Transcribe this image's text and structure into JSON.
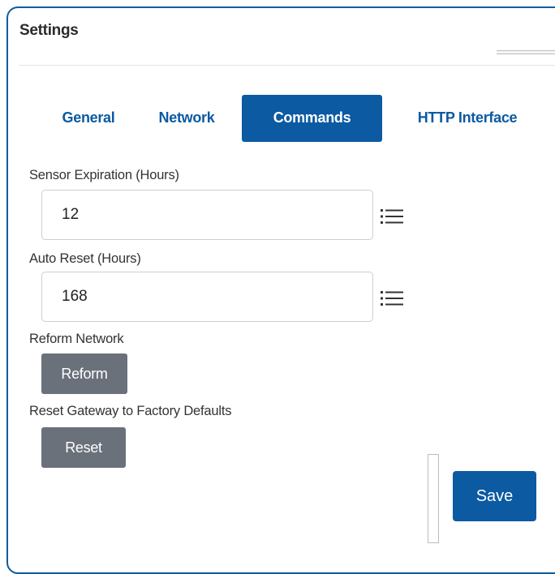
{
  "panel": {
    "title": "Settings"
  },
  "tabs": [
    {
      "label": "General",
      "active": false
    },
    {
      "label": "Network",
      "active": false
    },
    {
      "label": "Commands",
      "active": true
    },
    {
      "label": "HTTP Interface",
      "active": false
    }
  ],
  "fields": {
    "sensor_expiration": {
      "label": "Sensor Expiration (Hours)",
      "value": "12",
      "icon": "list-icon"
    },
    "auto_reset": {
      "label": "Auto Reset (Hours)",
      "value": "168",
      "icon": "list-icon"
    }
  },
  "actions": {
    "reform": {
      "label": "Reform Network",
      "button": "Reform"
    },
    "reset": {
      "label": "Reset Gateway to Factory Defaults",
      "button": "Reset"
    }
  },
  "footer": {
    "save_label": "Save"
  },
  "colors": {
    "accent": "#0b5aa2",
    "frame_border": "#0f5c9e",
    "secondary_button": "#6b717a"
  }
}
